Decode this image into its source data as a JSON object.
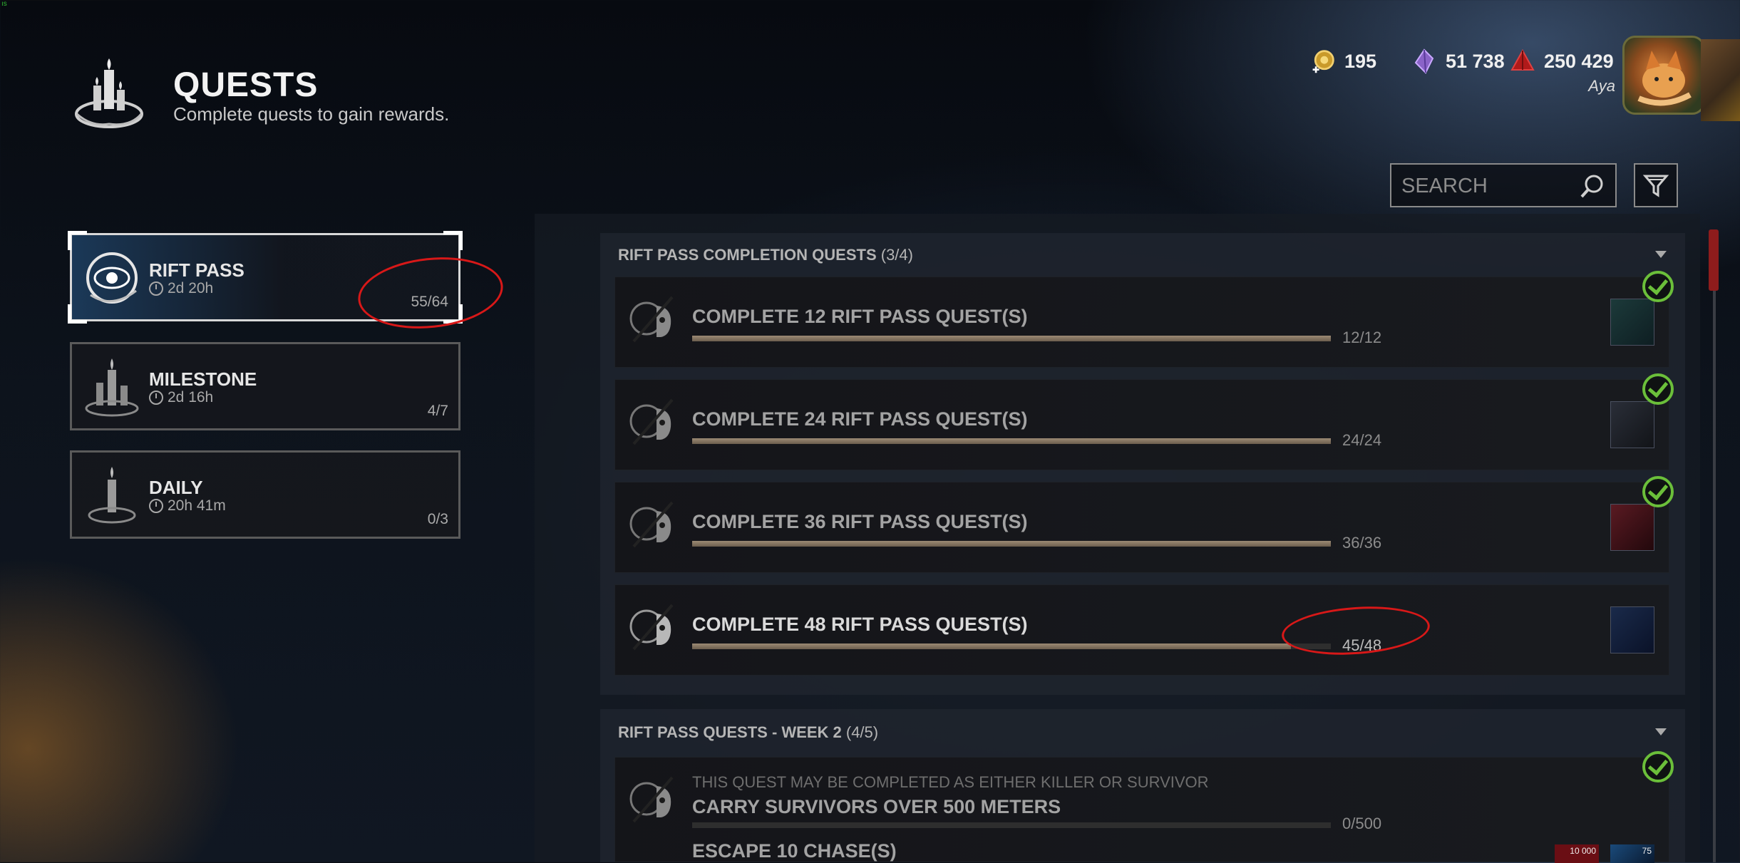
{
  "header": {
    "title": "QUESTS",
    "subtitle": "Complete quests to gain rewards."
  },
  "currencies": [
    {
      "icon": "auric-cells-icon",
      "value": "195"
    },
    {
      "icon": "iridescent-shards-icon",
      "value": "51 738"
    },
    {
      "icon": "bloodpoints-icon",
      "value": "250 429"
    }
  ],
  "user": {
    "name": "Aya"
  },
  "search": {
    "placeholder": "SEARCH"
  },
  "categories": [
    {
      "name": "RIFT PASS",
      "time": "2d 20h",
      "progress": "55/64",
      "active": true
    },
    {
      "name": "MILESTONE",
      "time": "2d 16h",
      "progress": "4/7",
      "active": false
    },
    {
      "name": "DAILY",
      "time": "20h 41m",
      "progress": "0/3",
      "active": false
    }
  ],
  "sections": [
    {
      "title": "RIFT PASS COMPLETION QUESTS",
      "count": "(3/4)",
      "quests": [
        {
          "title": "COMPLETE 12 RIFT PASS QUEST(S)",
          "progress": "12/12",
          "fraction": 1.0,
          "completed": true
        },
        {
          "title": "COMPLETE 24 RIFT PASS QUEST(S)",
          "progress": "24/24",
          "fraction": 1.0,
          "completed": true
        },
        {
          "title": "COMPLETE 36 RIFT PASS QUEST(S)",
          "progress": "36/36",
          "fraction": 1.0,
          "completed": true
        },
        {
          "title": "COMPLETE 48 RIFT PASS QUEST(S)",
          "progress": "45/48",
          "fraction": 0.9375,
          "completed": false
        }
      ]
    },
    {
      "title": "RIFT PASS QUESTS - WEEK 2",
      "count": "(4/5)",
      "quests": [
        {
          "note": "THIS QUEST MAY BE COMPLETED AS EITHER KILLER OR SURVIVOR",
          "title": "CARRY SURVIVORS OVER 500 METERS",
          "progress": "0/500",
          "fraction": 0.0,
          "completed": true,
          "reward_badges": [
            "10 000",
            "75"
          ]
        },
        {
          "title": "ESCAPE 10 CHASE(S)"
        }
      ]
    }
  ],
  "colors": {
    "accent_check": "#6bbf3a",
    "scroll_thumb": "#8e1c1c",
    "annotation": "#d81818"
  }
}
